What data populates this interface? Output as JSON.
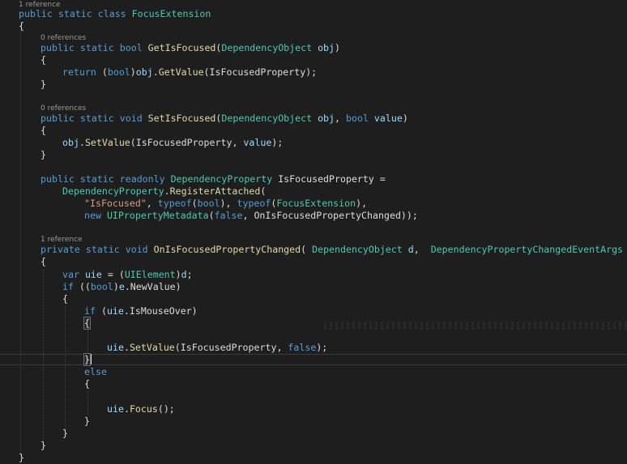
{
  "colors": {
    "background": "#1e1e1e",
    "keyword": "#569cd6",
    "type": "#4ec9b0",
    "method": "#dcdcaa",
    "variable": "#9cdcfe",
    "string": "#d69d85",
    "plain": "#dcdcdc",
    "codelens": "#999999"
  },
  "codelens": {
    "class_refs": "1 reference",
    "get_refs": "0 references",
    "set_refs": "0 references",
    "changed_refs": "1 reference"
  },
  "code": {
    "kw_public": "public",
    "kw_static": "static",
    "kw_class": "class",
    "kw_bool": "bool",
    "kw_return": "return",
    "kw_void": "void",
    "kw_readonly": "readonly",
    "kw_typeof": "typeof",
    "kw_new": "new",
    "kw_false": "false",
    "kw_private": "private",
    "kw_var": "var",
    "kw_if": "if",
    "kw_else": "else",
    "class_name": "FocusExtension",
    "type_dependency_object": "DependencyObject",
    "type_dependency_property": "DependencyProperty",
    "type_ui_property_metadata": "UIPropertyMetadata",
    "type_changed_event_args": "DependencyPropertyChangedEventArgs",
    "type_ui_element": "UIElement",
    "method_get_is_focused": "GetIsFocused",
    "method_get_value": "GetValue",
    "method_set_is_focused": "SetIsFocused",
    "method_set_value": "SetValue",
    "method_register_attached": "RegisterAttached",
    "method_on_changed": "OnIsFocusedPropertyChanged",
    "method_focus": "Focus",
    "var_obj": "obj",
    "var_value": "value",
    "var_d": "d",
    "var_e": "e",
    "var_uie": "uie",
    "field_is_focused_property": "IsFocusedProperty",
    "prop_new_value": "NewValue",
    "prop_is_mouse_over": "IsMouseOver",
    "string_is_focused": "\"IsFocused\"",
    "punct_open_brace": "{",
    "punct_close_brace": "}"
  }
}
